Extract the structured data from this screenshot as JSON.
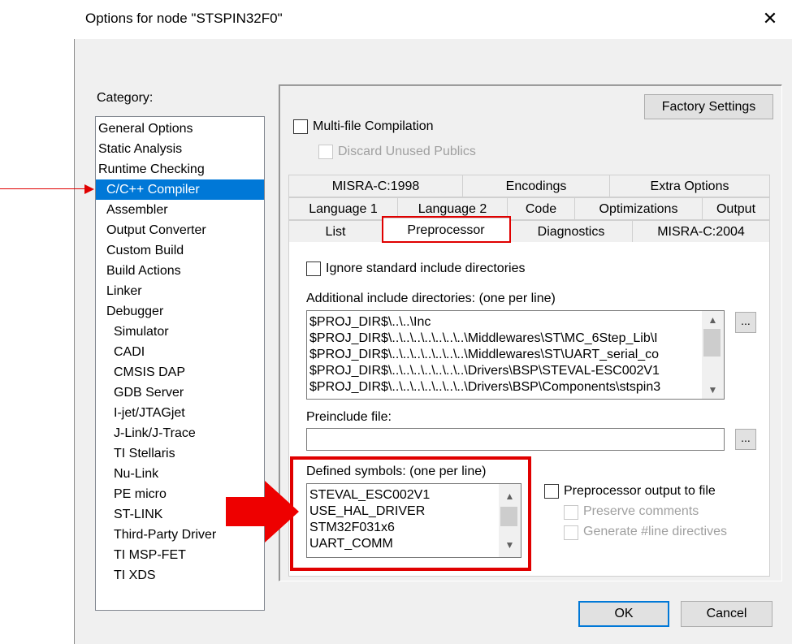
{
  "window": {
    "title": "Options for node \"STSPIN32F0\"",
    "close_glyph": "✕"
  },
  "category": {
    "label": "Category:",
    "items": [
      "General Options",
      "Static Analysis",
      "Runtime Checking",
      "C/C++ Compiler",
      "Assembler",
      "Output Converter",
      "Custom Build",
      "Build Actions",
      "Linker",
      "Debugger",
      "Simulator",
      "CADI",
      "CMSIS DAP",
      "GDB Server",
      "I-jet/JTAGjet",
      "J-Link/J-Trace",
      "TI Stellaris",
      "Nu-Link",
      "PE micro",
      "ST-LINK",
      "Third-Party Driver",
      "TI MSP-FET",
      "TI XDS"
    ],
    "selected": "C/C++ Compiler"
  },
  "factory_settings": "Factory Settings",
  "multifile": {
    "label": "Multi-file Compilation",
    "checked": false
  },
  "discard": {
    "label": "Discard Unused Publics",
    "checked": false,
    "enabled": false
  },
  "tabs": {
    "row1": [
      "MISRA-C:1998",
      "Encodings",
      "Extra Options"
    ],
    "row2": [
      "Language 1",
      "Language 2",
      "Code",
      "Optimizations",
      "Output"
    ],
    "row3": [
      "List",
      "Preprocessor",
      "Diagnostics",
      "MISRA-C:2004"
    ],
    "active": "Preprocessor"
  },
  "preprocessor": {
    "ignore_std": {
      "label": "Ignore standard include directories",
      "checked": false
    },
    "include_label": "Additional include directories: (one per line)",
    "include_lines": [
      "$PROJ_DIR$\\..\\..\\Inc",
      "$PROJ_DIR$\\..\\..\\..\\..\\..\\..\\..\\Middlewares\\ST\\MC_6Step_Lib\\I",
      "$PROJ_DIR$\\..\\..\\..\\..\\..\\..\\..\\Middlewares\\ST\\UART_serial_co",
      "$PROJ_DIR$\\..\\..\\..\\..\\..\\..\\..\\Drivers\\BSP\\STEVAL-ESC002V1",
      "$PROJ_DIR$\\..\\..\\..\\..\\..\\..\\..\\Drivers\\BSP\\Components\\stspin3"
    ],
    "browse_glyph": "...",
    "preinclude_label": "Preinclude file:",
    "preinclude_value": "",
    "defined_label": "Defined symbols: (one per line)",
    "defined_lines": [
      "STEVAL_ESC002V1",
      "USE_HAL_DRIVER",
      "STM32F031x6",
      "UART_COMM"
    ],
    "pp_output": {
      "label": "Preprocessor output to file",
      "checked": false
    },
    "preserve": {
      "label": "Preserve comments",
      "checked": false,
      "enabled": false
    },
    "line_directives": {
      "label": "Generate #line directives",
      "checked": false,
      "enabled": false
    }
  },
  "buttons": {
    "ok": "OK",
    "cancel": "Cancel"
  },
  "colors": {
    "selection": "#0078d7",
    "annotation_red": "#e00000",
    "dialog_bg": "#f0f0f0"
  }
}
